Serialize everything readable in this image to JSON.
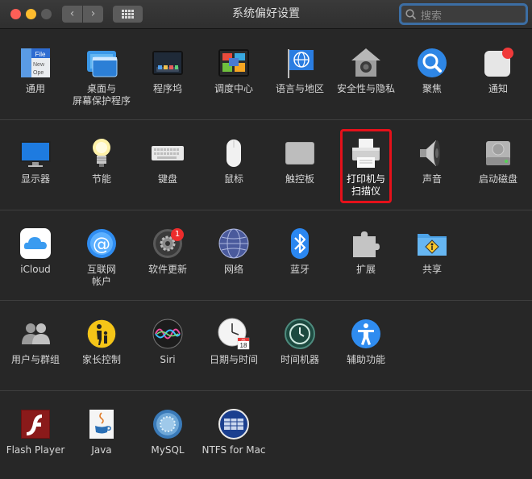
{
  "window": {
    "title": "系统偏好设置"
  },
  "toolbar": {
    "back": "‹",
    "forward": "›"
  },
  "search": {
    "placeholder": "搜索"
  },
  "sections": [
    {
      "items": [
        {
          "label": "通用"
        },
        {
          "label": "桌面与\n屏幕保护程序"
        },
        {
          "label": "程序坞"
        },
        {
          "label": "调度中心"
        },
        {
          "label": "语言与地区"
        },
        {
          "label": "安全性与隐私"
        },
        {
          "label": "聚焦"
        },
        {
          "label": "通知"
        }
      ]
    },
    {
      "items": [
        {
          "label": "显示器"
        },
        {
          "label": "节能"
        },
        {
          "label": "键盘"
        },
        {
          "label": "鼠标"
        },
        {
          "label": "触控板"
        },
        {
          "label": "打印机与\n扫描仪"
        },
        {
          "label": "声音"
        },
        {
          "label": "启动磁盘"
        }
      ]
    },
    {
      "items": [
        {
          "label": "iCloud"
        },
        {
          "label": "互联网\n帐户"
        },
        {
          "label": "软件更新",
          "badge": "1"
        },
        {
          "label": "网络"
        },
        {
          "label": "蓝牙"
        },
        {
          "label": "扩展"
        },
        {
          "label": "共享"
        }
      ]
    },
    {
      "items": [
        {
          "label": "用户与群组"
        },
        {
          "label": "家长控制"
        },
        {
          "label": "Siri"
        },
        {
          "label": "日期与时间"
        },
        {
          "label": "时间机器"
        },
        {
          "label": "辅助功能"
        }
      ]
    },
    {
      "items": [
        {
          "label": "Flash Player"
        },
        {
          "label": "Java"
        },
        {
          "label": "MySQL"
        },
        {
          "label": "NTFS for Mac"
        }
      ]
    }
  ],
  "icon_text": {
    "general_file": "File",
    "general_new": "New",
    "general_ope": "Ope",
    "calendar_month": "JUL",
    "calendar_day": "18"
  },
  "accent_color": "#3c6ea4",
  "highlight_color": "#e5111a"
}
